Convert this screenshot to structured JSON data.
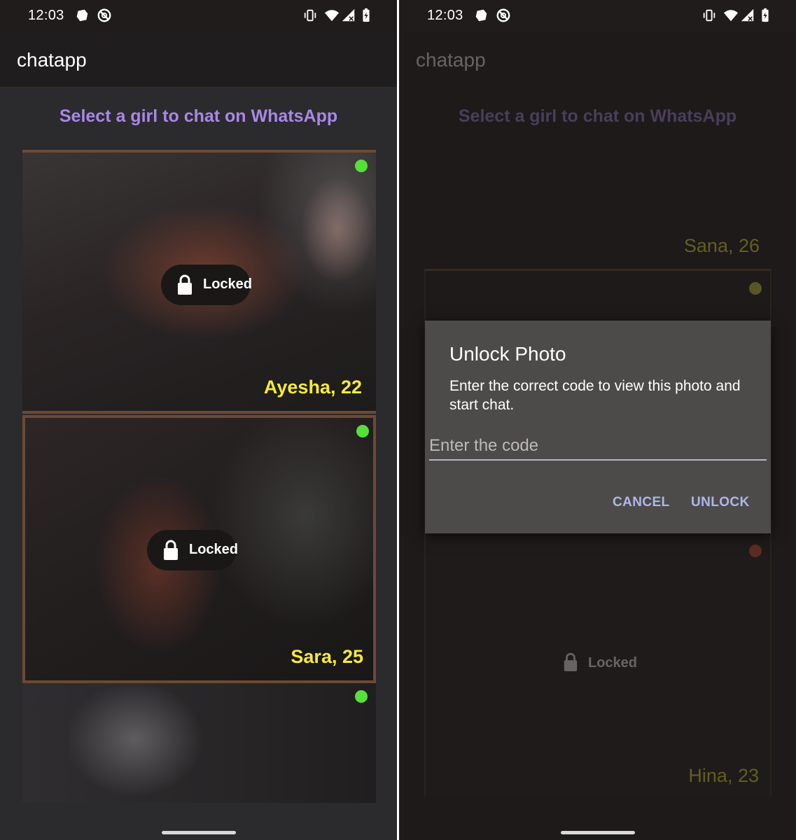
{
  "status_bar": {
    "time": "12:03",
    "left_icons": [
      "app-notification-icon",
      "do-not-disturb-icon"
    ],
    "right_icons": [
      "vibrate-icon",
      "wifi-icon",
      "cell-signal-icon",
      "battery-icon"
    ]
  },
  "app": {
    "title": "chatapp",
    "heading": "Select a girl to chat on WhatsApp"
  },
  "left_screen": {
    "cards": [
      {
        "name": "Ayesha, 22",
        "status": "Locked",
        "online_color": "#55e03a"
      },
      {
        "name": "Sara, 25",
        "status": "Locked",
        "online_color": "#55e03a"
      },
      {
        "name": "",
        "status": "",
        "online_color": "#55e03a"
      }
    ]
  },
  "right_screen": {
    "cards": [
      {
        "name": "Sana, 26",
        "online_color": "#d4d44a"
      },
      {
        "name": "Hina, 23",
        "status": "Locked",
        "online_color": "#e0503a"
      }
    ],
    "dialog": {
      "title": "Unlock Photo",
      "message": "Enter the correct code to view this photo and start chat.",
      "input_placeholder": "Enter the code",
      "input_value": "",
      "cancel_label": "CANCEL",
      "unlock_label": "UNLOCK"
    }
  },
  "colors": {
    "accent_heading": "#a987e6",
    "name_label": "#f4ea39",
    "card_border": "#6b4a36",
    "dialog_button": "#aeb7e7"
  }
}
